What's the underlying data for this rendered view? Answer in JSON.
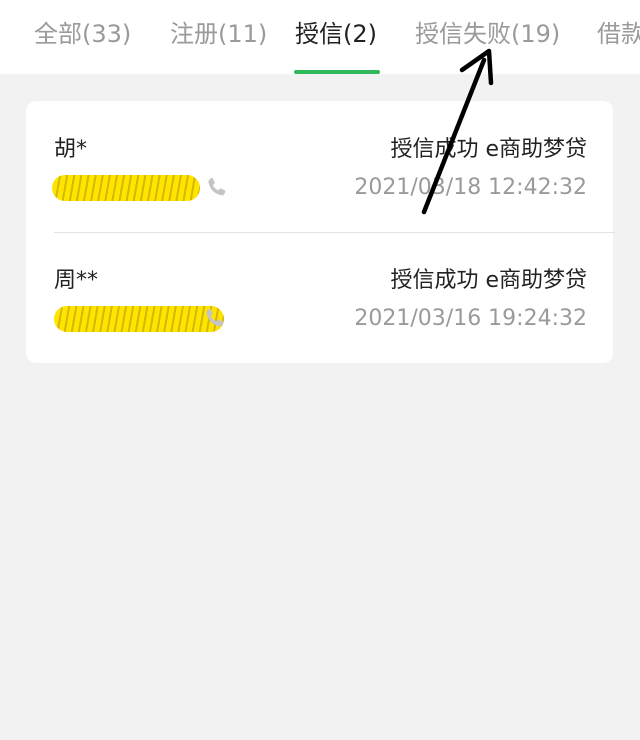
{
  "tabs": [
    {
      "label": "全部(33)"
    },
    {
      "label": "注册(11)"
    },
    {
      "label": "授信(2)"
    },
    {
      "label": "授信失败(19)"
    },
    {
      "label": "借款"
    }
  ],
  "records": [
    {
      "name": "胡*",
      "status": "授信成功 e商助梦贷",
      "time": "2021/03/18 12:42:32"
    },
    {
      "name": "周**",
      "status": "授信成功 e商助梦贷",
      "time": "2021/03/16 19:24:32"
    }
  ],
  "colors": {
    "active_tab_underline": "#2fb85c",
    "redaction": "#ffe400",
    "annotation_arrow": "#000000"
  },
  "icons": {
    "phone": "phone-icon",
    "annotation": "arrow-annotation-icon"
  }
}
